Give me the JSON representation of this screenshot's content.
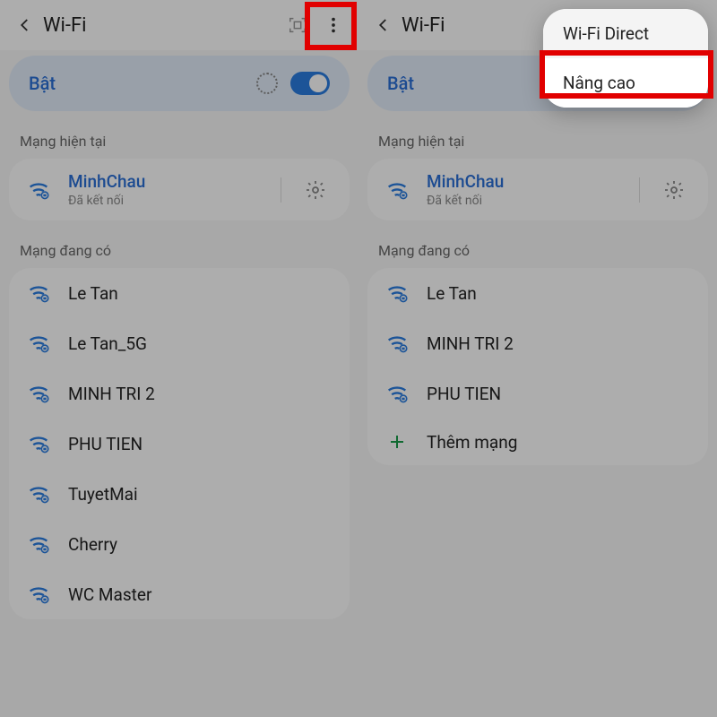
{
  "left": {
    "title": "Wi-Fi",
    "toggle_label": "Bật",
    "section_current": "Mạng hiện tại",
    "connected": {
      "name": "MinhChau",
      "status": "Đã kết nối"
    },
    "section_available": "Mạng đang có",
    "networks": [
      {
        "name": "Le Tan"
      },
      {
        "name": "Le Tan_5G"
      },
      {
        "name": "MINH TRI 2"
      },
      {
        "name": "PHU TIEN"
      },
      {
        "name": "TuyetMai"
      },
      {
        "name": "Cherry"
      },
      {
        "name": "WC Master"
      }
    ]
  },
  "right": {
    "title": "Wi-Fi",
    "toggle_label": "Bật",
    "section_current": "Mạng hiện tại",
    "connected": {
      "name": "MinhChau",
      "status": "Đã kết nối"
    },
    "section_available": "Mạng đang có",
    "networks": [
      {
        "name": "Le Tan"
      },
      {
        "name": "MINH TRI 2"
      },
      {
        "name": "PHU TIEN"
      }
    ],
    "add_network_label": "Thêm mạng",
    "menu": {
      "wifi_direct": "Wi-Fi Direct",
      "advanced": "Nâng cao"
    }
  }
}
